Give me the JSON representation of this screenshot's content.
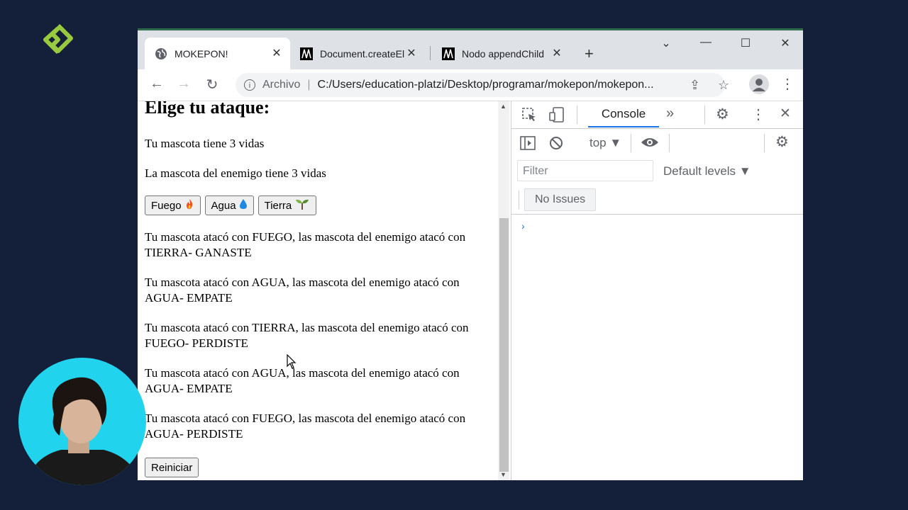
{
  "tabs": [
    {
      "label": "MOKEPON!",
      "icon": "globe-icon",
      "active": true
    },
    {
      "label": "Document.createEl",
      "icon": "mdn-icon",
      "active": false
    },
    {
      "label": "Nodo appendChild",
      "icon": "mdn-icon",
      "active": false
    }
  ],
  "address": {
    "scheme": "Archivo",
    "url": "C:/Users/education-platzi/Desktop/programar/mokepon/mokepon..."
  },
  "page": {
    "heading": "Elige tu ataque:",
    "player_lives": "Tu mascota tiene 3 vidas",
    "enemy_lives": "La mascota del enemigo tiene 3 vidas",
    "buttons": {
      "fuego": "Fuego",
      "agua": "Agua",
      "tierra": "Tierra",
      "reiniciar": "Reiniciar"
    },
    "messages": [
      "Tu mascota atacó con FUEGO, las mascota del enemigo atacó con TIERRA- GANASTE",
      "Tu mascota atacó con AGUA, las mascota del enemigo atacó con AGUA- EMPATE",
      "Tu mascota atacó con TIERRA, las mascota del enemigo atacó con FUEGO- PERDISTE",
      "Tu mascota atacó con AGUA, las mascota del enemigo atacó con AGUA- EMPATE",
      "Tu mascota atacó con FUEGO, las mascota del enemigo atacó con AGUA- PERDISTE"
    ]
  },
  "devtools": {
    "tab_console": "Console",
    "context": "top",
    "filter_placeholder": "Filter",
    "levels": "Default levels",
    "issues": "No Issues",
    "prompt": "›"
  },
  "colors": {
    "background": "#14203a",
    "logo": "#98ca3f",
    "webcam_bg": "#22d3ee",
    "accent": "#1a73e8"
  }
}
